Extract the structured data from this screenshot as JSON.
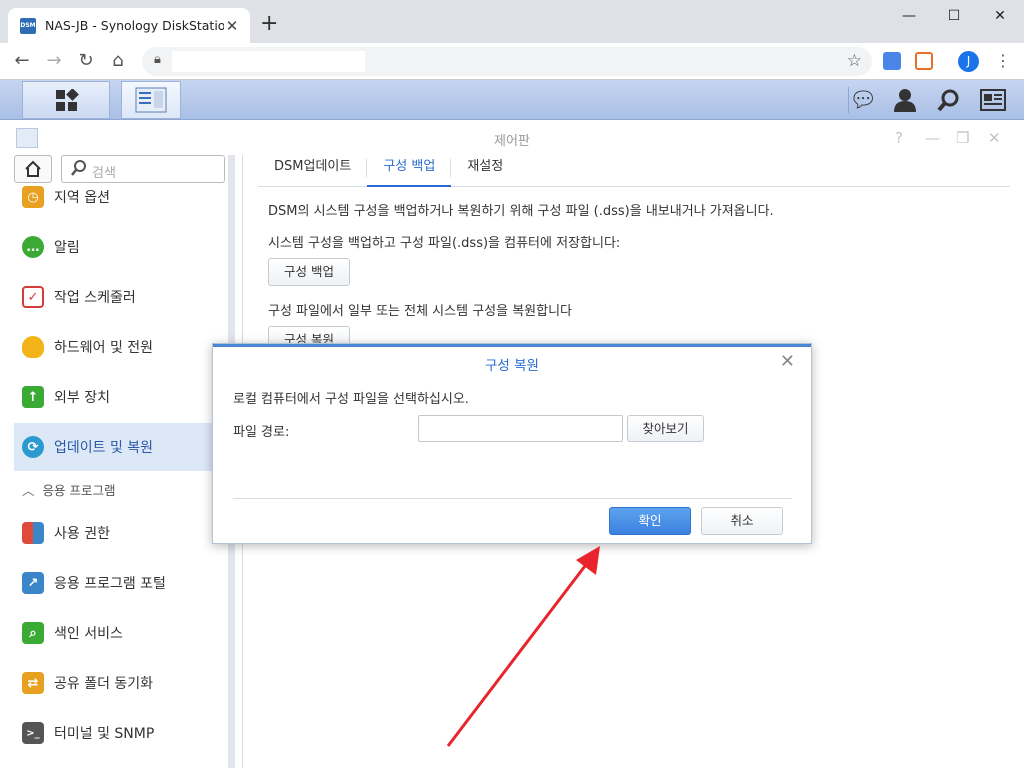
{
  "browser": {
    "tab_title": "NAS-JB - Synology DiskStation",
    "tab_close": "✕",
    "new_tab": "+",
    "favicon_text": "DSM",
    "minimize": "—",
    "maximize": "☐",
    "close": "✕",
    "avatar_initial": "J",
    "url": ""
  },
  "window": {
    "title": "제어판",
    "help": "?",
    "minimize": "—",
    "restore": "❐",
    "close": "✕"
  },
  "sidebar": {
    "search_placeholder": "검색",
    "items": [
      {
        "label": "지역 옵션",
        "icon": "regional-options-icon",
        "color": "#e8a020"
      },
      {
        "label": "알림",
        "icon": "notification-icon",
        "color": "#3aaa35"
      },
      {
        "label": "작업 스케줄러",
        "icon": "task-scheduler-icon",
        "color": "#d43b3b"
      },
      {
        "label": "하드웨어 및 전원",
        "icon": "hardware-power-icon",
        "color": "#f2b418"
      },
      {
        "label": "외부 장치",
        "icon": "external-devices-icon",
        "color": "#3aaa35"
      },
      {
        "label": "업데이트 및 복원",
        "icon": "update-restore-icon",
        "color": "#2a9ad1"
      },
      {
        "label": "사용 권한",
        "icon": "privileges-icon",
        "color": "#e04a3a"
      },
      {
        "label": "응용 프로그램 포털",
        "icon": "application-portal-icon",
        "color": "#3a86c8"
      },
      {
        "label": "색인 서비스",
        "icon": "indexing-service-icon",
        "color": "#3aaa35"
      },
      {
        "label": "공유 폴더 동기화",
        "icon": "shared-folder-sync-icon",
        "color": "#e8a020"
      },
      {
        "label": "터미널 및 SNMP",
        "icon": "terminal-snmp-icon",
        "color": "#555555"
      }
    ],
    "section_header": "응용 프로그램"
  },
  "main": {
    "tabs": [
      "DSM업데이트",
      "구성 백업",
      "재설정"
    ],
    "selected_tab": "구성 백업",
    "description": "DSM의 시스템 구성을 백업하거나 복원하기 위해 구성 파일 (.dss)을 내보내거나 가져옵니다.",
    "backup_text": "시스템 구성을 백업하고 구성 파일(.dss)을 컴퓨터에 저장합니다:",
    "backup_button": "구성 백업",
    "restore_text": "구성 파일에서 일부 또는 전체 시스템 구성을 복원합니다",
    "restore_button": "구성 복원"
  },
  "dialog": {
    "title": "구성 복원",
    "close": "✕",
    "message": "로컬 컴퓨터에서 구성 파일을 선택하십시오.",
    "file_path_label": "파일 경로:",
    "file_path_value": "",
    "browse_button": "찾아보기",
    "ok_button": "확인",
    "cancel_button": "취소"
  },
  "colors": {
    "accent": "#2a6bd1",
    "annotation_arrow": "#e8242c"
  }
}
